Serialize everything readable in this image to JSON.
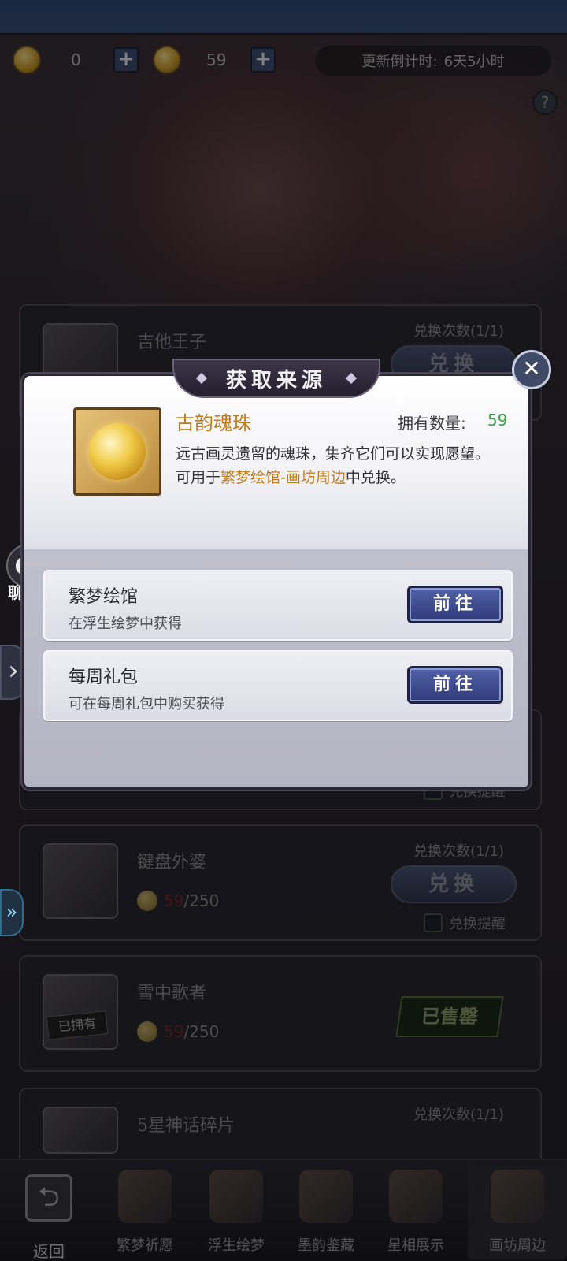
{
  "currency": {
    "coin1_value": "0",
    "coin2_value": "59",
    "plus_symbol": "+",
    "countdown_label": "更新倒计时:",
    "countdown_value": "6天5小时",
    "help_symbol": "?"
  },
  "cards": [
    {
      "name": "吉他王子",
      "times": "兑换次数(1/1)",
      "button": "兑换"
    },
    {
      "remind": "兑换提醒"
    },
    {
      "name": "键盘外婆",
      "have": "59",
      "cost": "/250",
      "times": "兑换次数(1/1)",
      "button": "兑换",
      "remind": "兑换提醒"
    },
    {
      "name": "雪中歌者",
      "have": "59",
      "cost": "/250",
      "status": "已售罄",
      "owned_tag": "已拥有"
    },
    {
      "name": "5星神话碎片",
      "times": "兑换次数(1/1)"
    }
  ],
  "chat": {
    "label": "聊天"
  },
  "side": {
    "arrow": "›",
    "arrow2": "»"
  },
  "modal": {
    "title": "获取来源",
    "close_symbol": "✕",
    "item": {
      "name": "古韵魂珠",
      "own_label": "拥有数量:",
      "own_value": "59",
      "desc_line1": "远古画灵遗留的魂珠，集齐它们可以实现愿望。",
      "desc_use_prefix": "可用于",
      "desc_use_highlight": "繁梦绘馆-画坊周边",
      "desc_use_suffix": "中兑换。"
    },
    "sources": [
      {
        "name": "繁梦绘馆",
        "desc": "在浮生绘梦中获得",
        "button": "前往"
      },
      {
        "name": "每周礼包",
        "desc": "可在每周礼包中购买获得",
        "button": "前往"
      }
    ]
  },
  "nav": {
    "back_label": "返回",
    "back_icon": "⮌",
    "items": [
      {
        "label": "繁梦祈愿"
      },
      {
        "label": "浮生绘梦"
      },
      {
        "label": "墨韵鉴藏"
      },
      {
        "label": "星相展示"
      },
      {
        "label": "画坊周边"
      }
    ]
  },
  "colors": {
    "accent": "#c07a18",
    "own_count": "#3aa04a",
    "button_blue": "#3f4c92"
  }
}
